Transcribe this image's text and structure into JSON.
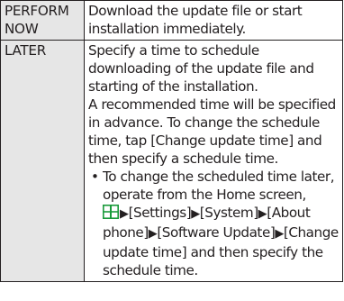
{
  "table": {
    "rows": [
      {
        "key": "PERFORM NOW",
        "paragraphs": [
          "Download the update file or start installation immediately."
        ]
      },
      {
        "key": "LATER",
        "paragraphs": [
          "Specify a time to schedule downloading of the update file and starting of the installation.",
          "A recommended time will be specified in advance. To change the schedule time, tap [Change update time] and then specify a schedule time."
        ],
        "bullet": {
          "mark": "•",
          "lead": "To change the scheduled time later, operate from the Home screen,",
          "path": [
            "[Settings]",
            "[System]",
            "[About phone]",
            "[Software Update]",
            "[Change update time]"
          ],
          "separator": "▶",
          "tail": "and then specify the schedule time.",
          "icon": "apps-grid-icon"
        }
      }
    ]
  },
  "colors": {
    "text": "#231f20",
    "border": "#231f20",
    "key_bg": "#e6e6e6",
    "icon_green": "#1a9b3c"
  }
}
